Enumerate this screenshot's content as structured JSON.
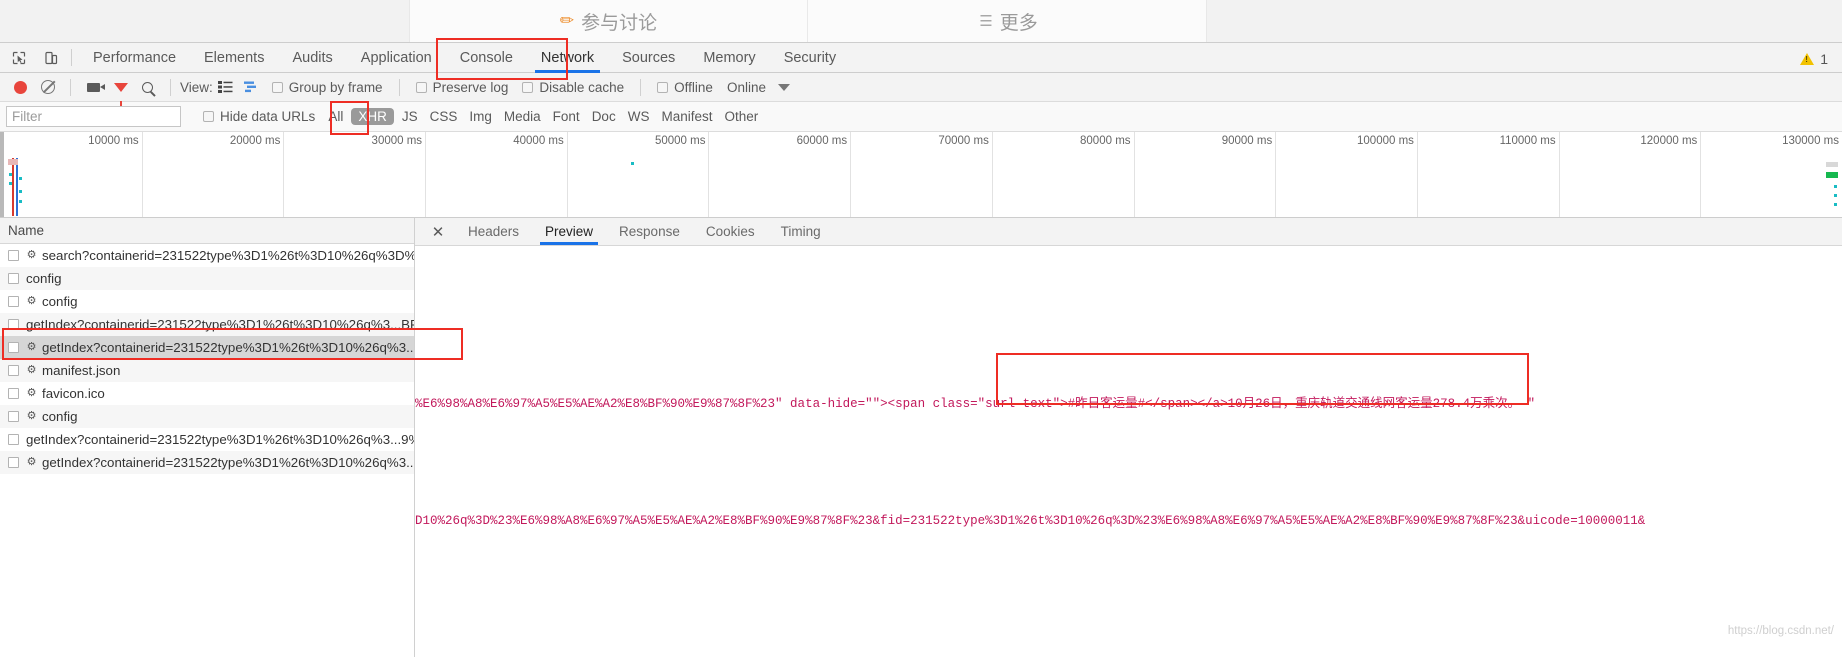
{
  "webpage_strip": {
    "discuss_button": "参与讨论",
    "discuss_icon": "pencil-square-icon",
    "more_button": "更多",
    "more_icon": "hamburger-icon"
  },
  "devtools": {
    "left_icons": [
      {
        "name": "inspect-element-icon",
        "glyph": "⬚"
      },
      {
        "name": "device-toolbar-icon",
        "glyph": "▭"
      }
    ],
    "tabs": [
      {
        "label": "Performance",
        "active": false
      },
      {
        "label": "Elements",
        "active": false
      },
      {
        "label": "Audits",
        "active": false
      },
      {
        "label": "Application",
        "active": false
      },
      {
        "label": "Console",
        "active": false
      },
      {
        "label": "Network",
        "active": true
      },
      {
        "label": "Sources",
        "active": false
      },
      {
        "label": "Memory",
        "active": false
      },
      {
        "label": "Security",
        "active": false
      }
    ],
    "warning_count": "1",
    "warning_icon": "warning-triangle-icon",
    "toolbar": {
      "record_icon": "record-circle-icon",
      "clear_icon": "clear-no-entry-icon",
      "screenshot_icon": "camera-icon",
      "filter_icon": "funnel-icon",
      "search_icon": "magnifier-icon",
      "view_label": "View:",
      "view_list_icon": "list-view-icon",
      "view_waterfall_icon": "waterfall-view-icon",
      "group_by_frame": "Group by frame",
      "preserve_log": "Preserve log",
      "disable_cache": "Disable cache",
      "offline": "Offline",
      "throttling_value": "Online",
      "throttling_caret_icon": "chevron-down-icon"
    },
    "filterbar": {
      "filter_placeholder": "Filter",
      "filter_value": "",
      "hide_data_urls": "Hide data URLs",
      "types": [
        {
          "label": "All",
          "selected": false
        },
        {
          "label": "XHR",
          "selected": true
        },
        {
          "label": "JS",
          "selected": false
        },
        {
          "label": "CSS",
          "selected": false
        },
        {
          "label": "Img",
          "selected": false
        },
        {
          "label": "Media",
          "selected": false
        },
        {
          "label": "Font",
          "selected": false
        },
        {
          "label": "Doc",
          "selected": false
        },
        {
          "label": "WS",
          "selected": false
        },
        {
          "label": "Manifest",
          "selected": false
        },
        {
          "label": "Other",
          "selected": false
        }
      ]
    },
    "timeline": {
      "ticks": [
        "10000 ms",
        "20000 ms",
        "30000 ms",
        "40000 ms",
        "50000 ms",
        "60000 ms",
        "70000 ms",
        "80000 ms",
        "90000 ms",
        "100000 ms",
        "110000 ms",
        "120000 ms",
        "130000 ms"
      ]
    },
    "requests": {
      "column_header": "Name",
      "rows": [
        {
          "name": "search?containerid=231522type%3D1%26t%3D10%26q%3D%.....",
          "has_gear": true,
          "selected": false
        },
        {
          "name": "config",
          "has_gear": false,
          "selected": false
        },
        {
          "name": "config",
          "has_gear": true,
          "selected": false
        },
        {
          "name": "getIndex?containerid=231522type%3D1%26t%3D10%26q%3...BF%...",
          "has_gear": false,
          "selected": false
        },
        {
          "name": "getIndex?containerid=231522type%3D1%26t%3D10%26q%3...B...",
          "has_gear": true,
          "selected": true
        },
        {
          "name": "manifest.json",
          "has_gear": true,
          "selected": false
        },
        {
          "name": "favicon.ico",
          "has_gear": true,
          "selected": false
        },
        {
          "name": "config",
          "has_gear": true,
          "selected": false
        },
        {
          "name": "getIndex?containerid=231522type%3D1%26t%3D10%26q%3...9%...",
          "has_gear": false,
          "selected": false
        },
        {
          "name": "getIndex?containerid=231522type%3D1%26t%3D10%26q%3...9...",
          "has_gear": true,
          "selected": false
        }
      ]
    },
    "detail": {
      "close_icon": "close-x-icon",
      "tabs": [
        {
          "label": "Headers",
          "active": false
        },
        {
          "label": "Preview",
          "active": true
        },
        {
          "label": "Response",
          "active": false
        },
        {
          "label": "Cookies",
          "active": false
        },
        {
          "label": "Timing",
          "active": false
        }
      ],
      "preview_line_1": "%E6%98%A8%E6%97%A5%E5%AE%A2%E8%BF%90%E9%87%8F%23\" data-hide=\"\"><span class=\"surl-text\">#昨日客运量#</span></a>10月26日，重庆轨道交通线网客运量278.4万乘次。   \"",
      "preview_line_2": "D10%26q%3D%23%E6%98%A8%E6%97%A5%E5%AE%A2%E8%BF%90%E9%87%8F%23&fid=231522type%3D1%26t%3D10%26q%3D%23%E6%98%A8%E6%97%A5%E5%AE%A2%E8%BF%90%E9%87%8F%23&uicode=10000011&"
    },
    "annotations": {
      "accent_color": "#ee2d24",
      "boxes": [
        "network-tab-highlight",
        "xhr-filter-highlight",
        "selected-request-highlight",
        "preview-text-highlight"
      ]
    },
    "watermark": "https://blog.csdn.net/"
  }
}
